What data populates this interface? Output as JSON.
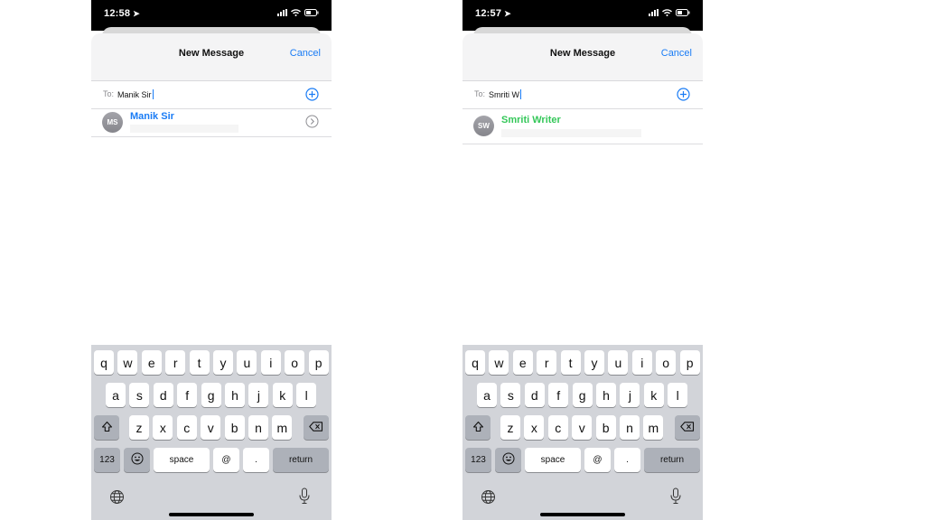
{
  "screens": [
    {
      "id": "left",
      "status": {
        "time": "12:58"
      },
      "nav": {
        "title": "New Message",
        "cancel": "Cancel"
      },
      "to": {
        "label": "To:",
        "value": "Manik Sir"
      },
      "suggestion": {
        "initials": "MS",
        "name": "Manik Sir",
        "name_color": "#1a7cf5"
      }
    },
    {
      "id": "right",
      "status": {
        "time": "12:57"
      },
      "nav": {
        "title": "New Message",
        "cancel": "Cancel"
      },
      "to": {
        "label": "To:",
        "value": "Smriti W"
      },
      "suggestion": {
        "initials": "SW",
        "name": "Smriti Writer",
        "name_color": "#34c759"
      }
    }
  ],
  "keyboard": {
    "row1": [
      "q",
      "w",
      "e",
      "r",
      "t",
      "y",
      "u",
      "i",
      "o",
      "p"
    ],
    "row2": [
      "a",
      "s",
      "d",
      "f",
      "g",
      "h",
      "j",
      "k",
      "l"
    ],
    "row3": [
      "z",
      "x",
      "c",
      "v",
      "b",
      "n",
      "m"
    ],
    "numbers_key": "123",
    "space_key": "space",
    "at_key": "@",
    "period_key": ".",
    "return_key": "return",
    "shift_icon": "shift-icon",
    "delete_icon": "backspace-icon",
    "emoji_icon": "emoji-icon",
    "globe_icon": "globe-icon",
    "mic_icon": "microphone-icon"
  },
  "colors": {
    "accent": "#1a7cf5",
    "imessage_green": "#34c759"
  }
}
